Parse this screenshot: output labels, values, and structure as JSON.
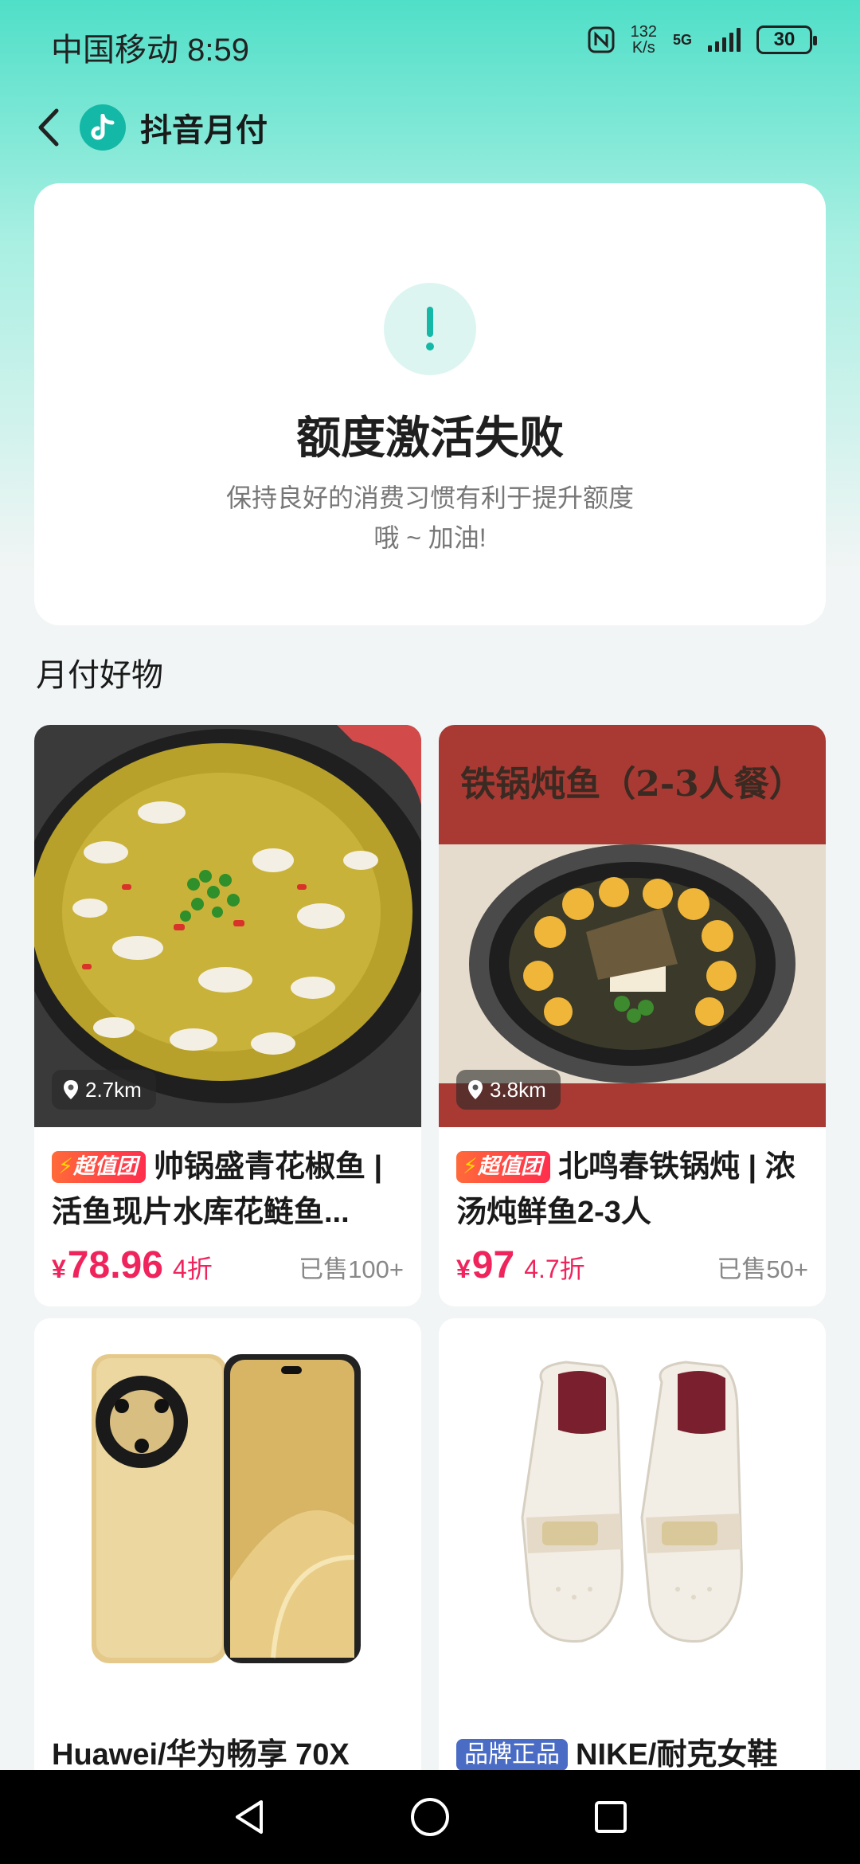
{
  "status_bar": {
    "carrier_time": "中国移动 8:59",
    "net_speed_value": "132",
    "net_speed_unit": "K/s",
    "network": "5G",
    "battery": "30"
  },
  "header": {
    "title": "抖音月付"
  },
  "status_card": {
    "title": "额度激活失败",
    "desc_line1": "保持良好的消费习惯有利于提升额度",
    "desc_line2": "哦 ~ 加油!"
  },
  "section": {
    "title": "月付好物"
  },
  "products": [
    {
      "distance": "2.7km",
      "tag": "超值团",
      "title": "帅锅盛青花椒鱼 | 活鱼现片水库花鲢鱼...",
      "price": "78.96",
      "currency": "¥",
      "discount": "4折",
      "sold": "已售100+"
    },
    {
      "distance": "3.8km",
      "tag": "超值团",
      "title": "北鸣春铁锅炖 | 浓汤炖鲜鱼2-3人",
      "image_text": "铁锅炖鱼（2-3人餐）",
      "price": "97",
      "currency": "¥",
      "discount": "4.7折",
      "sold": "已售50+"
    },
    {
      "title": "Huawei/华为畅享 70X"
    },
    {
      "tag": "品牌正品",
      "title": "NIKE/耐克女鞋"
    }
  ],
  "colors": {
    "accent": "#14b8a6",
    "price": "#f0245c",
    "brand_tag": "#4a6cc4"
  }
}
